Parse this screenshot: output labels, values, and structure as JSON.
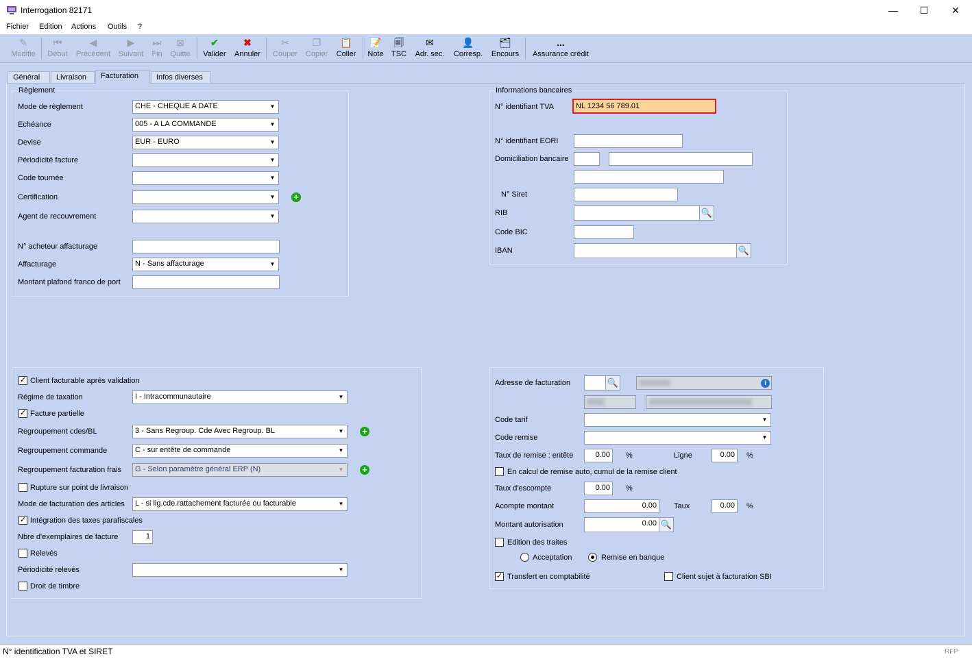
{
  "window": {
    "title": "Interrogation 82171",
    "minimize": "—",
    "maximize": "☐",
    "close": "✕"
  },
  "menu": [
    "Fichier",
    "Edition",
    "Actions",
    "Outils",
    "?"
  ],
  "toolbar": {
    "modifie": "Modifie",
    "debut": "Début",
    "precedent": "Précédent",
    "suivant": "Suivant",
    "fin": "Fin",
    "quitte": "Quitte",
    "valider": "Valider",
    "annuler": "Annuler",
    "couper": "Couper",
    "copier": "Copier",
    "coller": "Coller",
    "note": "Note",
    "tsc": "TSC",
    "adr_sec": "Adr. sec.",
    "corresp": "Corresp.",
    "encours": "Encours",
    "assurance": "Assurance crédit",
    "assurance_icon": "..."
  },
  "tabs": [
    "Général",
    "Livraison",
    "Facturation",
    "Infos diverses"
  ],
  "active_tab": "Facturation",
  "reglement": {
    "title": "Règlement",
    "mode_reglement": {
      "label": "Mode de règlement",
      "value": "CHE - CHEQUE A DATE"
    },
    "echeance": {
      "label": "Echéance",
      "value": "005 - A LA COMMANDE"
    },
    "devise": {
      "label": "Devise",
      "value": "EUR - EURO"
    },
    "periodicite_facture": {
      "label": "Périodicité facture",
      "value": ""
    },
    "code_tournee": {
      "label": "Code tournée",
      "value": ""
    },
    "certification": {
      "label": "Certification",
      "value": ""
    },
    "agent_recouvrement": {
      "label": "Agent de recouvrement",
      "value": ""
    },
    "acheteur_affacturage": {
      "label": "N° acheteur affacturage",
      "value": ""
    },
    "affacturage": {
      "label": "Affacturage",
      "value": "N - Sans affacturage"
    },
    "montant_plafond": {
      "label": "Montant plafond franco de port",
      "value": ""
    }
  },
  "banque": {
    "title": "Informations bancaires",
    "tva": {
      "label": "N° identifiant TVA",
      "value": "NL 1234 56 789.01"
    },
    "eori": {
      "label": "N° identifiant EORI",
      "value": ""
    },
    "domiciliation": {
      "label": "Domiciliation bancaire",
      "value": ""
    },
    "siret": {
      "label": "N° Siret",
      "value": ""
    },
    "rib": {
      "label": "RIB",
      "value": ""
    },
    "bic": {
      "label": "Code BIC",
      "value": ""
    },
    "iban": {
      "label": "IBAN",
      "value": ""
    }
  },
  "facturation": {
    "client_facturable": {
      "label": "Client facturable après validation",
      "checked": true
    },
    "regime_taxation": {
      "label": "Régime de taxation",
      "value": "I - Intracommunautaire"
    },
    "facture_partielle": {
      "label": "Facture partielle",
      "checked": true
    },
    "regroupement_cdes": {
      "label": "Regroupement cdes/BL",
      "value": "3 - Sans Regroup. Cde Avec Regroup. BL"
    },
    "regroupement_commande": {
      "label": "Regroupement commande",
      "value": "C - sur entête de commande"
    },
    "regroupement_frais": {
      "label": "Regroupement facturation frais",
      "value": "G - Selon paramètre général ERP (N)"
    },
    "rupture_livraison": {
      "label": "Rupture sur point de livraison",
      "checked": false
    },
    "mode_facturation_articles": {
      "label": "Mode de facturation des articles",
      "value": "L - si lig.cde.rattachement facturée ou facturable"
    },
    "integration_taxes": {
      "label": "Intégration des taxes parafiscales",
      "checked": true
    },
    "nbre_exemplaires": {
      "label": "Nbre d'exemplaires de facture",
      "value": "1"
    },
    "releves": {
      "label": "Relevés",
      "checked": false
    },
    "periodicite_releves": {
      "label": "Périodicité relevés",
      "value": ""
    },
    "droit_timbre": {
      "label": "Droit de timbre",
      "checked": false
    }
  },
  "adresse": {
    "adresse_facturation": {
      "label": "Adresse de facturation",
      "value": ""
    },
    "code_tarif": {
      "label": "Code tarif",
      "value": ""
    },
    "code_remise": {
      "label": "Code remise",
      "value": ""
    },
    "taux_remise": {
      "label": "Taux de remise : entête",
      "value": "0.00",
      "unit": "%"
    },
    "ligne": {
      "label": "Ligne",
      "value": "0.00",
      "unit": "%"
    },
    "calcul_remise": {
      "label": "En calcul de remise auto, cumul de la remise client",
      "checked": false
    },
    "taux_escompte": {
      "label": "Taux d'escompte",
      "value": "0.00",
      "unit": "%"
    },
    "acompte_montant": {
      "label": "Acompte montant",
      "value": "0.00"
    },
    "acompte_taux": {
      "label": "Taux",
      "value": "0.00",
      "unit": "%"
    },
    "montant_autorisation": {
      "label": "Montant autorisation",
      "value": "0.00"
    },
    "edition_traites": {
      "label": "Edition des traites",
      "checked": false
    },
    "acceptation": {
      "label": "Acceptation",
      "selected": false
    },
    "remise_banque": {
      "label": "Remise en banque",
      "selected": true
    },
    "transfert_compta": {
      "label": "Transfert en comptabilité",
      "checked": true
    },
    "client_sbi": {
      "label": "Client sujet à facturation SBI",
      "checked": false
    }
  },
  "status": {
    "text": "N° identification TVA et SIRET",
    "right": "RFP"
  },
  "colors": {
    "panel": "#c5d3f0",
    "highlight_field": "#fcd49a",
    "highlight_border": "#e02020",
    "plus_green": "#1aa31a"
  },
  "icons": [
    "app-icon",
    "modifie-icon",
    "debut-icon",
    "precedent-icon",
    "suivant-icon",
    "fin-icon",
    "quitte-icon",
    "valider-check-icon",
    "annuler-x-icon",
    "couper-scissors-icon",
    "copier-icon",
    "coller-clipboard-icon",
    "note-icon",
    "tsc-icon",
    "adr-sec-envelope-icon",
    "corresp-icon",
    "encours-icon",
    "search-icon",
    "add-plus-icon",
    "info-icon",
    "chevron-down-icon"
  ]
}
